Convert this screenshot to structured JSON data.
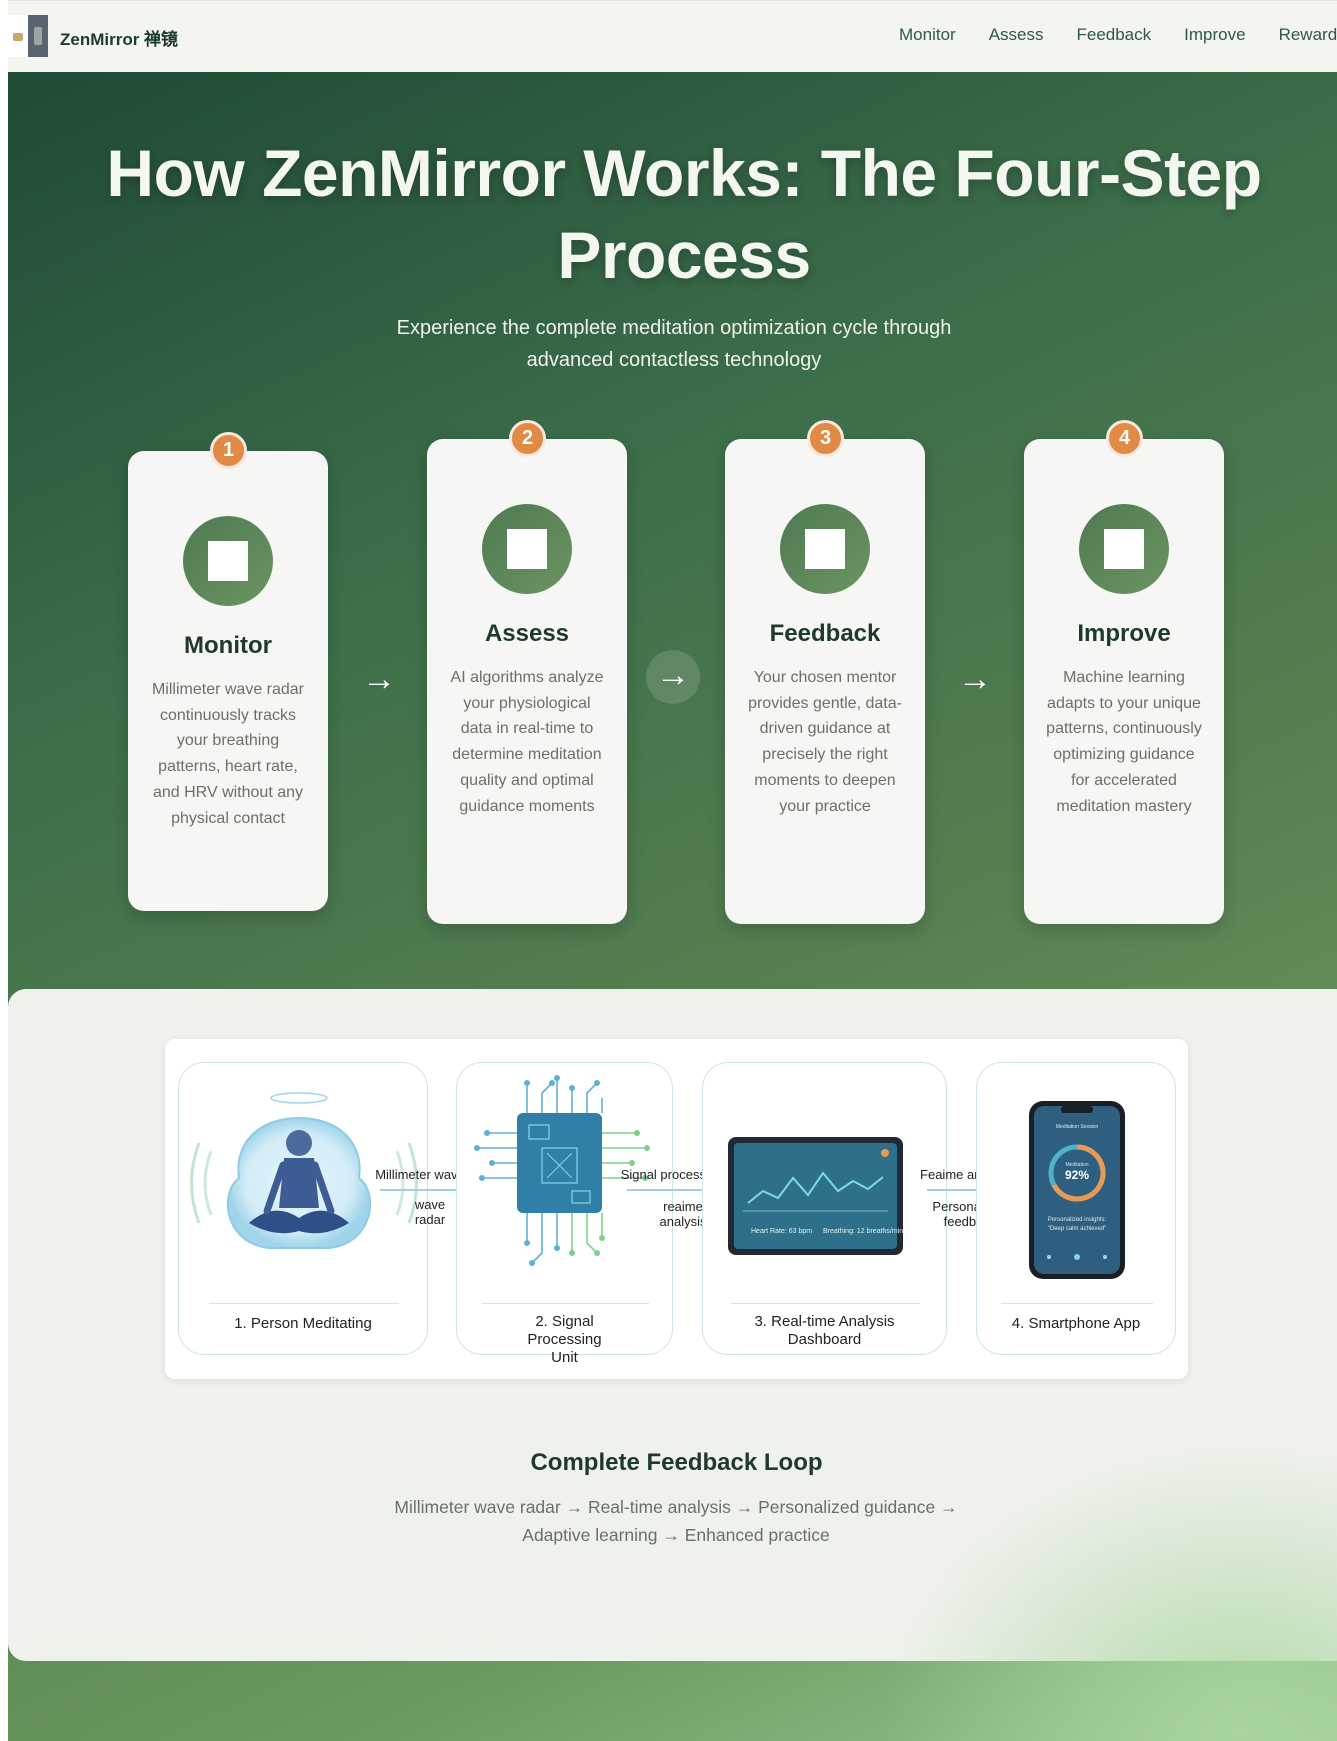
{
  "brand": {
    "name": "ZenMirror 禅镜"
  },
  "nav": {
    "links": [
      "Monitor",
      "Assess",
      "Feedback",
      "Improve",
      "Rewards"
    ]
  },
  "hero": {
    "title": "How ZenMirror Works: The Four-Step Process",
    "subtitle": "Experience the complete meditation optimization cycle through advanced contactless technology"
  },
  "steps": [
    {
      "number": "1",
      "title": "Monitor",
      "text": "Millimeter wave radar continuously tracks your breathing patterns, heart rate, and HRV without any physical contact"
    },
    {
      "number": "2",
      "title": "Assess",
      "text": "AI algorithms analyze your physiological data in real-time to determine meditation quality and optimal guidance moments"
    },
    {
      "number": "3",
      "title": "Feedback",
      "text": "Your chosen mentor provides gentle, data-driven guidance at precisely the right moments to deepen your practice"
    },
    {
      "number": "4",
      "title": "Improve",
      "text": "Machine learning adapts to your unique patterns, continuously optimizing guidance for accelerated meditation mastery"
    }
  ],
  "arrows": [
    "→",
    "→",
    "→"
  ],
  "diagram": {
    "captions": [
      "1. Person Meditating",
      "2. Signal Processing Unit",
      "3. Real-time Analysis Dashboard",
      "4. Smartphone App"
    ],
    "flows": [
      {
        "top": "Millimeter wave",
        "bottom": "wave radar"
      },
      {
        "top": "Signal processing",
        "bottom": "reaime analysis"
      },
      {
        "top": "Feaime analysis",
        "bottom": "Personalized feedback"
      }
    ],
    "dashboard": {
      "heart": "Heart Rate: 63 bpm",
      "breathing": "Breathing: 12 breaths/min"
    },
    "phone": {
      "title": "Meditation Session",
      "score_label": "Meditation",
      "score": "92%",
      "insight_1": "Personalized insights:",
      "insight_2": "\"Deep calm achieved\""
    }
  },
  "loop": {
    "title": "Complete Feedback Loop",
    "text": "Millimeter wave radar → Real-time analysis → Personalized guidance → Adaptive learning → Enhanced practice"
  }
}
